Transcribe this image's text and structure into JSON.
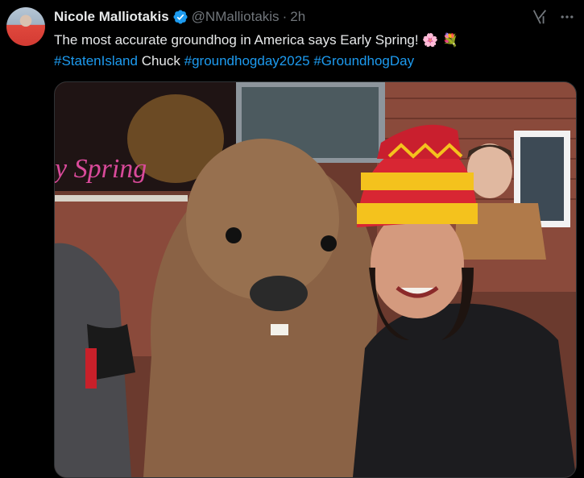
{
  "author": {
    "name": "Nicole Malliotakis",
    "handle": "@NMalliotakis",
    "separator": "·",
    "time": "2h",
    "verified": true
  },
  "tweet": {
    "text_before": "The most accurate groundhog in America says Early Spring!",
    "emoji_1": "🌸",
    "emoji_2": "💐",
    "hashtag_1": "#StatenIsland",
    "plain_word": "Chuck",
    "hashtag_2": "#groundhogday2025",
    "hashtag_3": "#GroundhogDay"
  },
  "media": {
    "sign_text": "y Spring"
  },
  "colors": {
    "background": "#000000",
    "text": "#e7e9ea",
    "muted": "#71767b",
    "link": "#1d9bf0",
    "verified": "#1d9bf0"
  },
  "icons": {
    "verified": "verified-badge-icon",
    "grok": "grok-icon",
    "more": "more-options-icon"
  }
}
